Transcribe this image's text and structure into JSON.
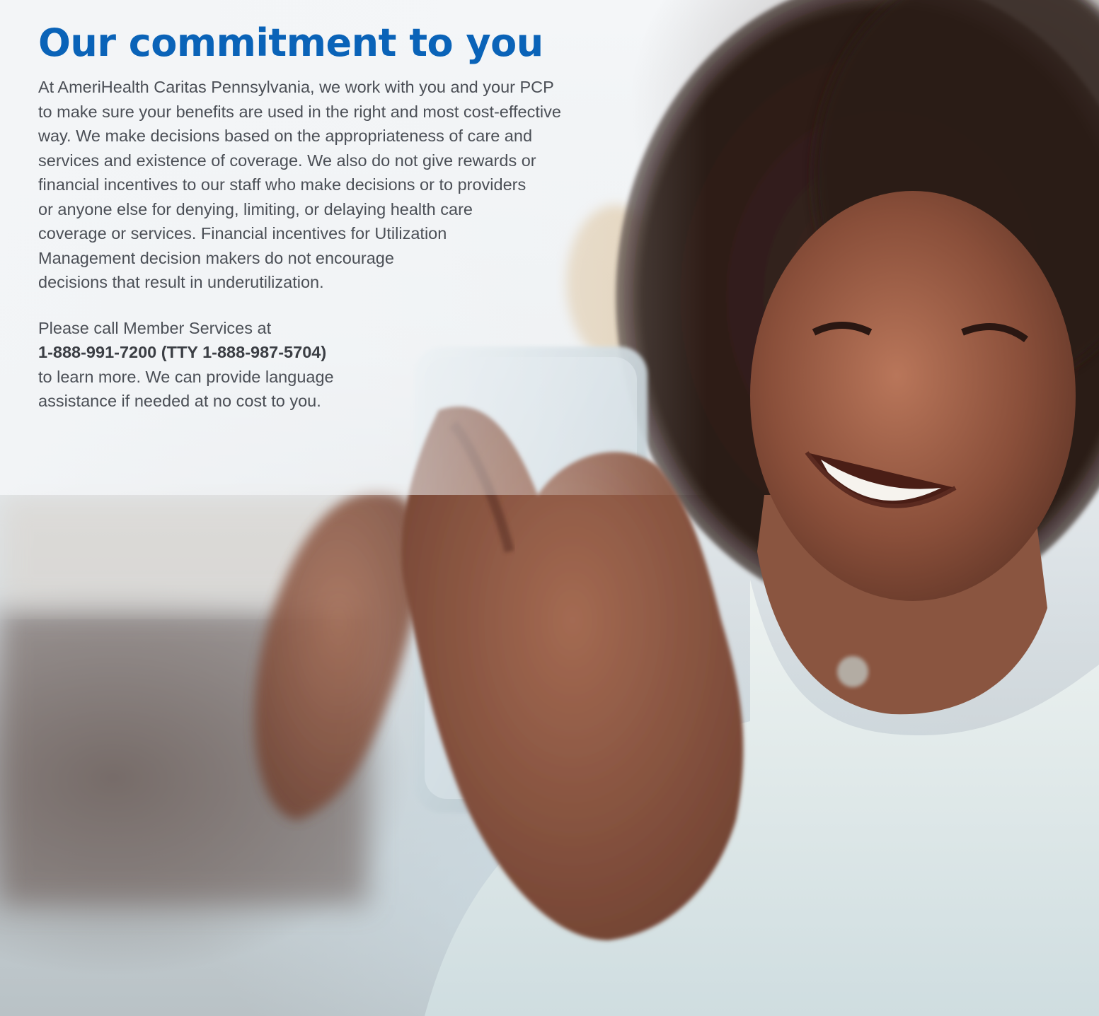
{
  "heading": "Our commitment to you",
  "body_paragraph": "At AmeriHealth Caritas Pennsylvania, we work with you and your PCP\nto make sure your benefits are used in the right and most cost-effective\nway. We make decisions based on the appropriateness of care and\nservices and existence of coverage. We also do not give rewards or\nfinancial incentives to our staff who make decisions or to providers\nor anyone else for denying, limiting, or delaying health care\ncoverage or services. Financial incentives for Utilization\nManagement decision makers do not encourage\ndecisions that result in underutilization.",
  "contact": {
    "line1": "Please call Member Services at",
    "phone": "1-888-991-7200 (TTY 1-888-987-5704)",
    "line3": "to learn more. We can provide language",
    "line4": "assistance if needed at no cost to you."
  },
  "colors": {
    "heading": "#0a63b8",
    "body_text": "#4b4f56"
  },
  "image": {
    "icon": "photo-woman-smiling-with-phone"
  }
}
